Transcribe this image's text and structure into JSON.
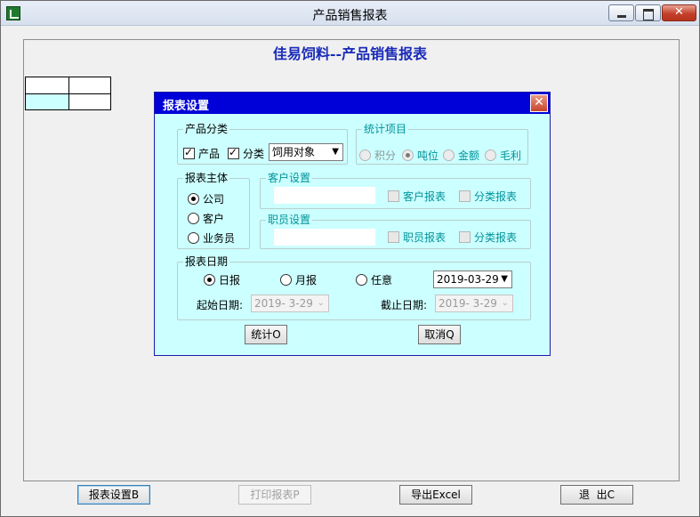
{
  "window": {
    "title": "产品销售报表"
  },
  "report": {
    "title": "佳易饲料--产品销售报表"
  },
  "dialog": {
    "title": "报表设置",
    "close_glyph": "✕",
    "product_category": {
      "legend": "产品分类",
      "product_label": "产品",
      "product_checked": true,
      "category_label": "分类",
      "category_checked": true,
      "category_select": "饲用对象"
    },
    "stat_items": {
      "legend": "统计项目",
      "options": [
        "积分",
        "吨位",
        "金额",
        "毛利"
      ],
      "selected": "吨位"
    },
    "subject": {
      "legend": "报表主体",
      "options": [
        "公司",
        "客户",
        "业务员"
      ],
      "selected": "公司"
    },
    "customer": {
      "legend": "客户设置",
      "input_value": "",
      "report_label": "客户报表",
      "category_report_label": "分类报表"
    },
    "staff": {
      "legend": "职员设置",
      "input_value": "",
      "report_label": "职员报表",
      "category_report_label": "分类报表"
    },
    "report_date": {
      "legend": "报表日期",
      "options": [
        "日报",
        "月报",
        "任意"
      ],
      "selected": "日报",
      "date_value": "2019-03-29",
      "start_label": "起始日期:",
      "start_value": "2019- 3-29",
      "end_label": "截止日期:",
      "end_value": "2019- 3-29"
    },
    "stat_button": "统计O",
    "cancel_button": "取消Q"
  },
  "toolbar": {
    "settings_button": "报表设置B",
    "print_button": "打印报表P",
    "export_button": "导出Excel",
    "exit_button": "退  出C"
  },
  "colors": {
    "dialog_bg": "#ccffff",
    "dialog_title_bg": "#0000d8",
    "report_title": "#1a2bb8",
    "teal_label": "#00939a"
  }
}
